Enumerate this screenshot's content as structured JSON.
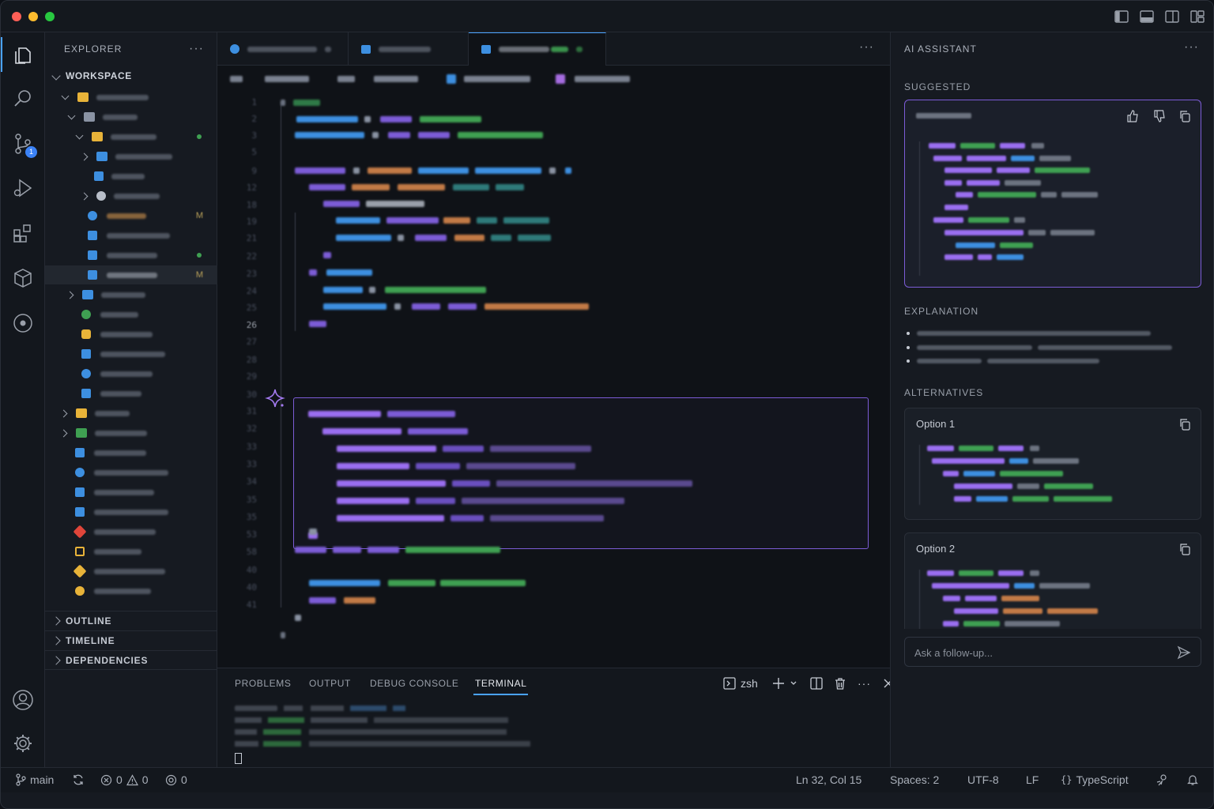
{
  "explorer": {
    "title": "EXPLORER",
    "more": "···",
    "workspace": "WORKSPACE"
  },
  "tree": [
    {
      "type": "folder",
      "modified": false
    },
    {
      "type": "folder",
      "modified": false
    },
    {
      "type": "folder",
      "modified": false,
      "added": true
    },
    {
      "type": "folder",
      "modified": false
    },
    {
      "type": "file",
      "modified": false
    },
    {
      "type": "folder",
      "modified": false
    },
    {
      "type": "file",
      "modified": true
    },
    {
      "type": "file",
      "modified": false
    },
    {
      "type": "file",
      "added": true
    },
    {
      "type": "file",
      "modified": true,
      "selected": true
    }
  ],
  "tree_flags": {
    "modified": "M"
  },
  "sections": [
    "OUTLINE",
    "TIMELINE",
    "DEPENDENCIES"
  ],
  "editor": {
    "more": "···",
    "line_numbers": [
      "1",
      "2",
      "3",
      "5",
      "9",
      "12",
      "18",
      "19",
      "21",
      "22",
      "23",
      "24",
      "25",
      "26",
      "27",
      "28",
      "29",
      "30",
      "31",
      "32",
      "33",
      "33",
      "34",
      "35",
      "35",
      "53",
      "58",
      "40",
      "40",
      "41"
    ],
    "current_line": "26"
  },
  "panel": {
    "tabs": [
      "PROBLEMS",
      "OUTPUT",
      "DEBUG CONSOLE",
      "TERMINAL"
    ],
    "active_tab": "TERMINAL",
    "shell": "zsh"
  },
  "ai": {
    "title": "AI ASSISTANT",
    "more": "···",
    "suggested_label": "SUGGESTED",
    "explanation_label": "EXPLANATION",
    "alternatives_label": "ALTERNATIVES",
    "option1": "Option 1",
    "option2": "Option 2",
    "ask_placeholder": "Ask a follow-up..."
  },
  "status": {
    "branch": "main",
    "errors": "0",
    "warnings": "0",
    "ports": "0",
    "position": "Ln 32, Col 15",
    "spaces": "Spaces: 2",
    "encoding": "UTF-8",
    "eol": "LF",
    "language": "TypeScript"
  },
  "colors": {
    "accent": "#4aa3ff",
    "ai_accent": "#7c5cd6",
    "added": "#3fa052",
    "modified": "#b8a05a"
  }
}
